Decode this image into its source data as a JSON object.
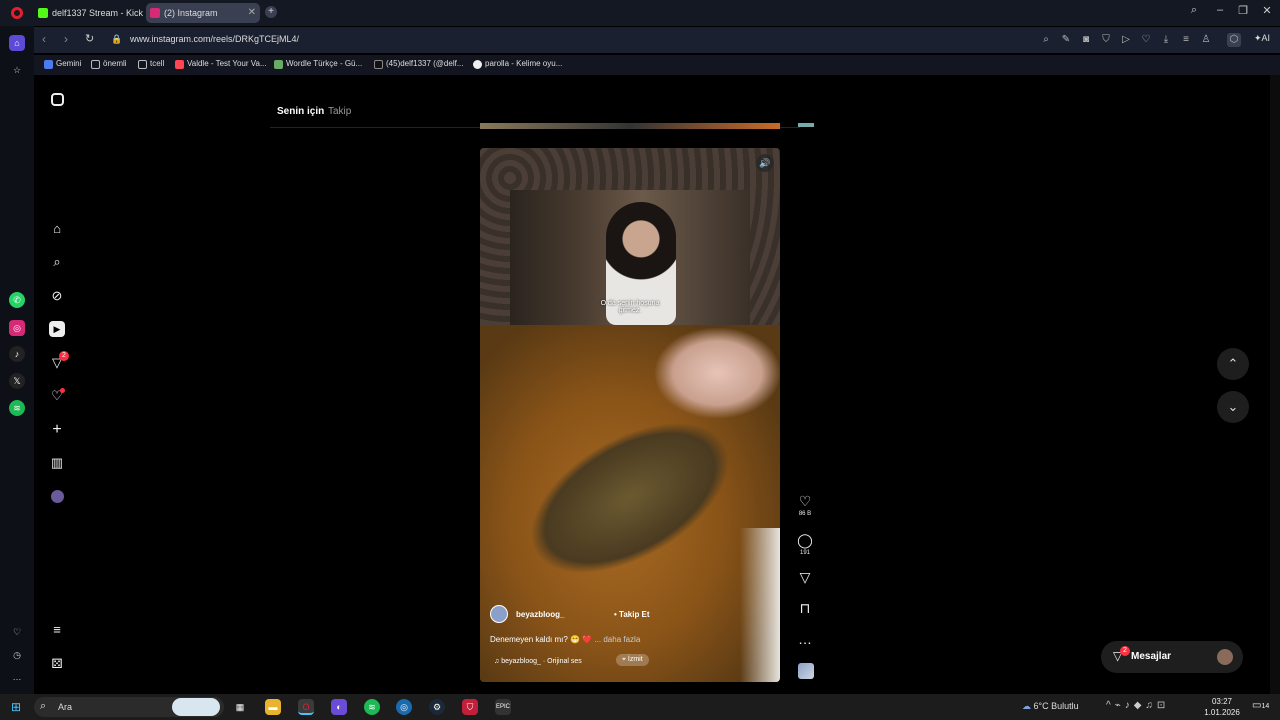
{
  "tabs": [
    {
      "title": "delf1337 Stream - Kick Da",
      "color": "#53fc18"
    },
    {
      "title": "(2) Instagram",
      "color": "#d62976"
    }
  ],
  "address": {
    "url": "www.instagram.com/reels/DRKgTCEjML4/",
    "ai_label": "AI"
  },
  "bookmarks": [
    {
      "label": "Gemini",
      "color": "#4b7bec"
    },
    {
      "label": "önemli",
      "color": "#888"
    },
    {
      "label": "tcell",
      "color": "#888"
    },
    {
      "label": "Valdle - Test Your Va...",
      "color": "#ff4655"
    },
    {
      "label": "Wordle Türkçe - Gü...",
      "color": "#6aaa64"
    },
    {
      "label": "(45)delf1337 (@delf...",
      "color": "#111"
    },
    {
      "label": "parolla - Kelime oyu...",
      "color": "#eee"
    }
  ],
  "opera_badge": "2",
  "ig": {
    "tab_for_you": "Senin için",
    "tab_following": "Takip",
    "notification_count": "2",
    "reel": {
      "subtitle_line1": "O da senin hoşuna",
      "subtitle_line2": "gitmez.",
      "username": "beyazbloog_",
      "follow": "Takip Et",
      "caption": "Denemeyen kaldı mı?",
      "caption_emoji": "😁 ❤️",
      "more": "... daha fazla",
      "audio": "beyazbloog_ · Orijinal ses",
      "location": "İzmit"
    },
    "actions": {
      "likes": "86 B",
      "comments": "191"
    },
    "messages": {
      "label": "Mesajlar",
      "badge": "2"
    }
  },
  "taskbar": {
    "search": "Ara",
    "weather": "6°C  Bulutlu",
    "time": "03:27",
    "date": "1.01.2026",
    "notif": "14"
  }
}
